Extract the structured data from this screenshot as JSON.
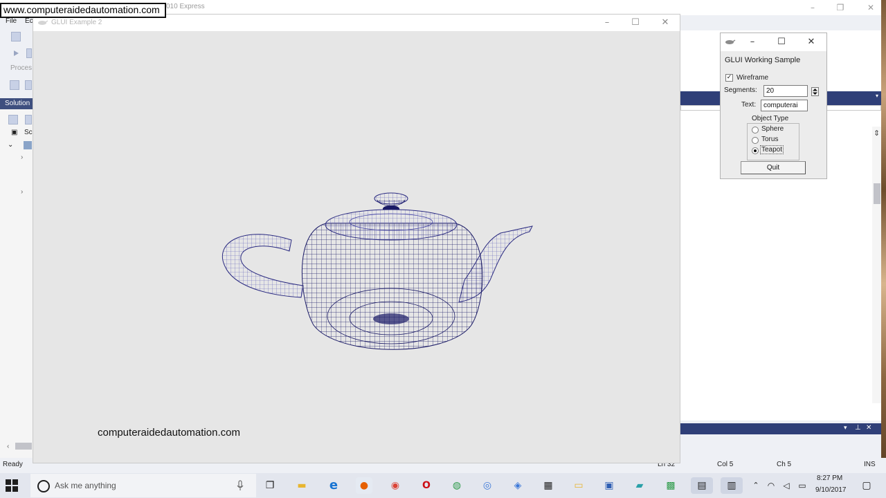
{
  "watermark": "www.computeraidedautomation.com",
  "ide": {
    "title_fragment": "010 Express",
    "menu": [
      "File",
      "Ec"
    ],
    "process_label": "Proces",
    "solution_title": "Solution",
    "tree_item": "Sc",
    "status": {
      "ready": "Ready",
      "line": "Ln 32",
      "col": "Col 5",
      "ch": "Ch 5",
      "ins": "INS"
    }
  },
  "main_window": {
    "title": "GLUI Example 2",
    "render_label": "computeraidedautomation.com",
    "object_shown": "teapot",
    "wireframe_color": "#1a1a66"
  },
  "panel": {
    "title": "GLUI Working Sample",
    "wireframe_label": "Wireframe",
    "wireframe_checked": true,
    "segments_label": "Segments:",
    "segments_value": "20",
    "text_label": "Text:",
    "text_value": "computerai",
    "group_label": "Object Type",
    "options": [
      "Sphere",
      "Torus",
      "Teapot"
    ],
    "selected_option": "Teapot",
    "quit_label": "Quit"
  },
  "taskbar": {
    "search_placeholder": "Ask me anything",
    "time": "8:27 PM",
    "date": "9/10/2017",
    "apps": [
      "task-view",
      "file-explorer",
      "edge",
      "firefox",
      "chrome",
      "opera",
      "maps",
      "network",
      "folder",
      "calculator",
      "photos",
      "visual-studio",
      "notepad",
      "store",
      "glui-app",
      "glui-panel"
    ]
  },
  "colors": {
    "ide_blue": "#2f3f78",
    "taskbar": "#e3e6ee",
    "render_bg": "#e6e6e6"
  }
}
